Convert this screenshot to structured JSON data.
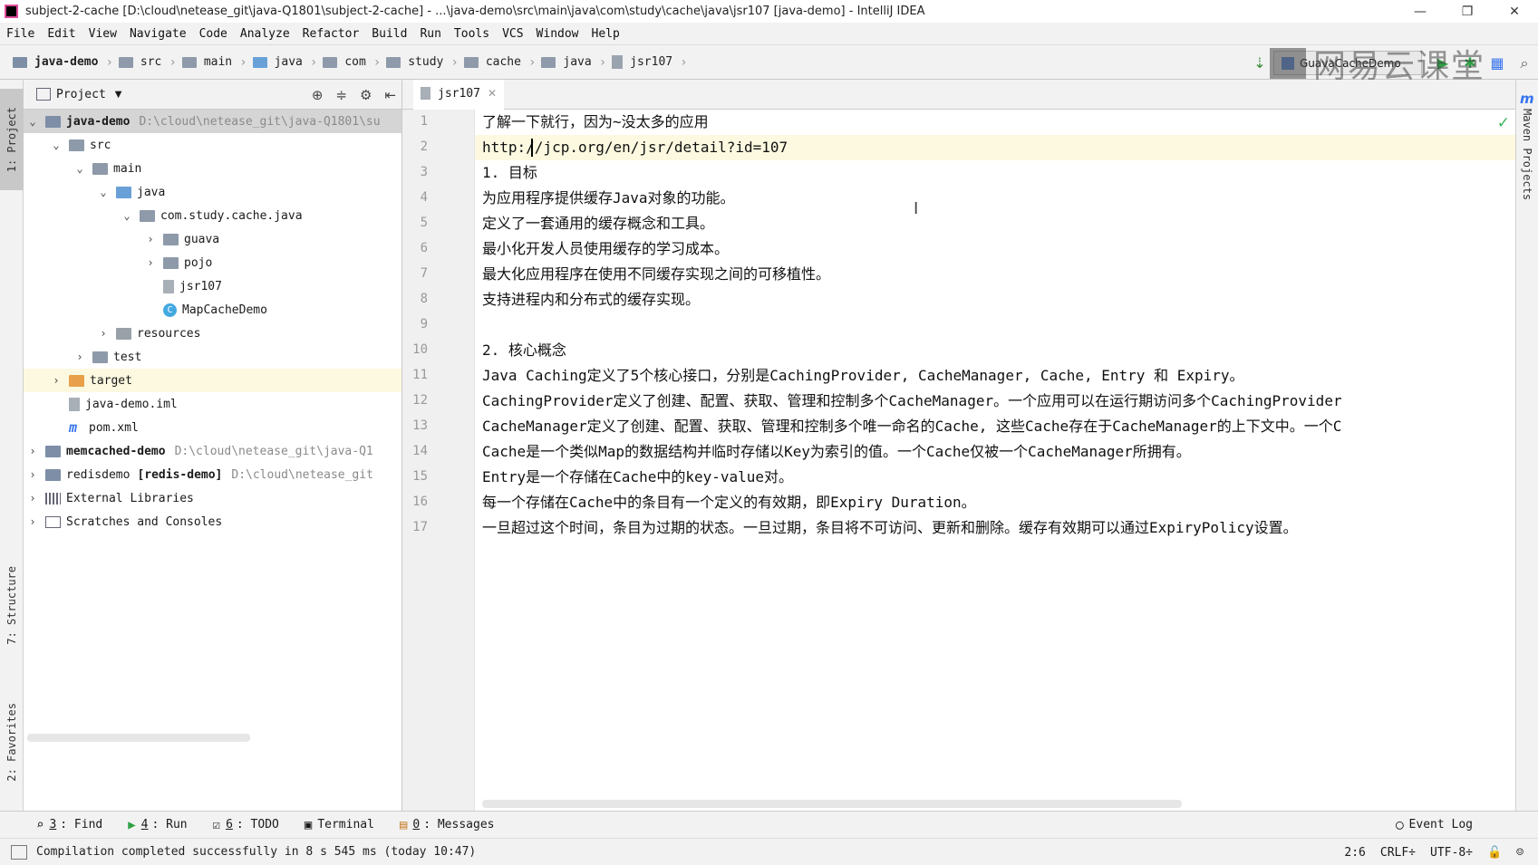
{
  "window": {
    "title": "subject-2-cache [D:\\cloud\\netease_git\\java-Q1801\\subject-2-cache] - ...\\java-demo\\src\\main\\java\\com\\study\\cache\\java\\jsr107 [java-demo] - IntelliJ IDEA",
    "minimize": "—",
    "restore": "❐",
    "close": "✕"
  },
  "menu": [
    "File",
    "Edit",
    "View",
    "Navigate",
    "Code",
    "Analyze",
    "Refactor",
    "Build",
    "Run",
    "Tools",
    "VCS",
    "Window",
    "Help"
  ],
  "breadcrumbs": [
    "java-demo",
    "src",
    "main",
    "java",
    "com",
    "study",
    "cache",
    "java",
    "jsr107"
  ],
  "toolbar": {
    "run_config": "GuavaCacheDemo",
    "watermark": "网易云课堂"
  },
  "left_tabs": {
    "project": "1: Project",
    "structure": "7: Structure",
    "favorites": "2: Favorites"
  },
  "project_panel": {
    "title": "Project",
    "tree": [
      {
        "label": "java-demo",
        "path": "D:\\cloud\\netease_git\\java-Q1801\\su"
      },
      {
        "label": "src"
      },
      {
        "label": "main"
      },
      {
        "label": "java"
      },
      {
        "label": "com.study.cache.java"
      },
      {
        "label": "guava"
      },
      {
        "label": "pojo"
      },
      {
        "label": "jsr107"
      },
      {
        "label": "MapCacheDemo"
      },
      {
        "label": "resources"
      },
      {
        "label": "test"
      },
      {
        "label": "target"
      },
      {
        "label": "java-demo.iml"
      },
      {
        "label": "pom.xml"
      },
      {
        "label": "memcached-demo",
        "path": "D:\\cloud\\netease_git\\java-Q1"
      },
      {
        "label": "redisdemo",
        "bold_part": "[redis-demo]",
        "path": "D:\\cloud\\netease_git"
      },
      {
        "label": "External Libraries"
      },
      {
        "label": "Scratches and Consoles"
      }
    ]
  },
  "editor": {
    "tab": "jsr107",
    "lines": [
      "了解一下就行，因为~没太多的应用",
      "http://jcp.org/en/jsr/detail?id=107",
      "1. 目标",
      "为应用程序提供缓存Java对象的功能。",
      "定义了一套通用的缓存概念和工具。",
      "最小化开发人员使用缓存的学习成本。",
      "最大化应用程序在使用不同缓存实现之间的可移植性。",
      "支持进程内和分布式的缓存实现。",
      "",
      "2. 核心概念",
      "Java Caching定义了5个核心接口，分别是CachingProvider, CacheManager, Cache, Entry 和 Expiry。",
      "CachingProvider定义了创建、配置、获取、管理和控制多个CacheManager。一个应用可以在运行期访问多个CachingProvider",
      "CacheManager定义了创建、配置、获取、管理和控制多个唯一命名的Cache, 这些Cache存在于CacheManager的上下文中。一个C",
      "Cache是一个类似Map的数据结构并临时存储以Key为索引的值。一个Cache仅被一个CacheManager所拥有。",
      "Entry是一个存储在Cache中的key-value对。",
      "每一个存储在Cache中的条目有一个定义的有效期，即Expiry Duration。",
      "一旦超过这个时间，条目为过期的状态。一旦过期，条目将不可访问、更新和删除。缓存有效期可以通过ExpiryPolicy设置。"
    ],
    "line_numbers": [
      "1",
      "2",
      "3",
      "4",
      "5",
      "6",
      "7",
      "8",
      "9",
      "10",
      "11",
      "12",
      "13",
      "14",
      "15",
      "16",
      "17"
    ]
  },
  "right_tab": "Maven Projects",
  "bottom_tools": [
    {
      "num": "3",
      "label": ": Find"
    },
    {
      "num": "4",
      "label": ": Run"
    },
    {
      "num": "6",
      "label": ": TODO"
    },
    {
      "num": "",
      "label": "Terminal"
    },
    {
      "num": "0",
      "label": ": Messages"
    }
  ],
  "event_log": "Event Log",
  "status": {
    "message": "Compilation completed successfully in 8 s 545 ms (today 10:47)",
    "position": "2:6",
    "line_sep": "CRLF÷",
    "encoding": "UTF-8÷"
  }
}
